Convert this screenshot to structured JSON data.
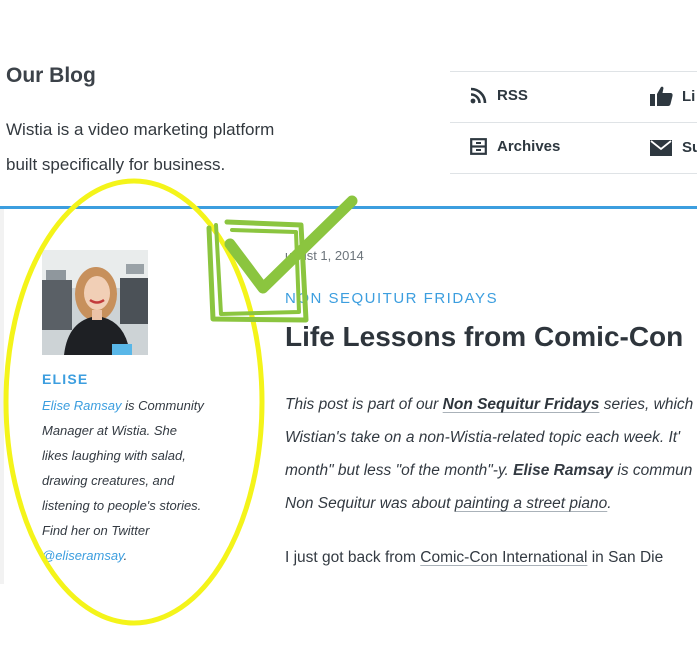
{
  "header": {
    "title": "Our Blog",
    "tagline_line1": "Wistia is a video marketing platform",
    "tagline_line2": "built specifically for business."
  },
  "links": {
    "rss": "RSS",
    "like": "Li",
    "archives": "Archives",
    "subscribe": "Su"
  },
  "author": {
    "name": "ELISE",
    "bio_link": "Elise Ramsay",
    "bio_line1_rest": " is Community",
    "bio_line2": "Manager at Wistia. She",
    "bio_line3": "likes laughing with salad,",
    "bio_line4": "drawing creatures, and",
    "bio_line5": "listening to people's stories.",
    "bio_line6": "Find her on Twitter",
    "twitter_handle": "@eliseramsay",
    "twitter_suffix": "."
  },
  "post": {
    "date": "ugust 1, 2014",
    "category": "NON SEQUITUR FRIDAYS",
    "title": "Life Lessons from Comic-Con",
    "intro_l1_a": "This post is part of our ",
    "intro_l1_link": "Non Sequitur Fridays",
    "intro_l1_b": " series, which",
    "intro_l2": "Wistian's take on a non-Wistia-related topic each week. It'",
    "intro_l3_a": "month\" but less \"of the month\"-y. ",
    "intro_l3_bold": "Elise Ramsay",
    "intro_l3_b": " is commun",
    "intro_l4_a": "Non Sequitur was about ",
    "intro_l4_link": "painting a street piano",
    "intro_l4_b": ".",
    "body_a": "I just got back from ",
    "body_link": "Comic-Con International",
    "body_b": " in San Die"
  },
  "colors": {
    "accent_blue": "#3c9edf",
    "highlight_yellow": "#f4f41a",
    "check_green": "#8bc53f"
  },
  "icons": {
    "rss": "rss-icon",
    "like": "thumbs-up-icon",
    "archives": "archive-box-icon",
    "subscribe": "envelope-icon"
  }
}
